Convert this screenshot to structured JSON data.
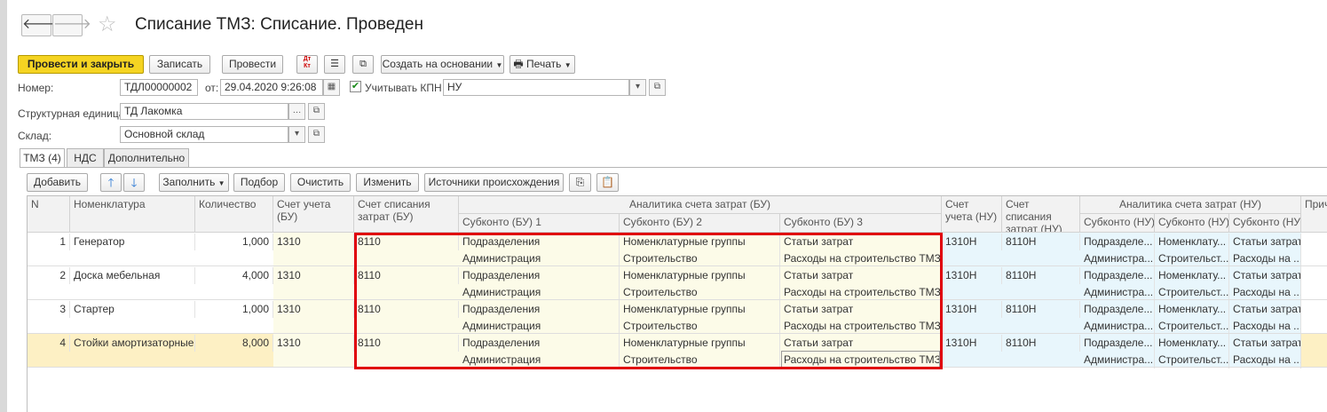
{
  "window": {
    "title": "Списание ТМЗ: Списание. Проведен"
  },
  "nav": {
    "back_glyph": "🡐",
    "forward_glyph": "🡒",
    "star_glyph": "☆"
  },
  "toolbar": {
    "post_close": "Провести и закрыть",
    "save": "Записать",
    "post": "Провести",
    "dtkt": "Дт Кт",
    "create_based": "Создать на основании",
    "print": "Печать"
  },
  "form": {
    "number_label": "Номер:",
    "number_value": "ТДЛ00000002",
    "date_label": "от:",
    "date_value": "29.04.2020  9:26:08",
    "kpn_label": "Учитывать КПН",
    "kpn_checked": true,
    "tax_value": "НУ",
    "unit_label": "Структурная единица:",
    "unit_value": "ТД Лакомка",
    "warehouse_label": "Склад:",
    "warehouse_value": "Основной склад"
  },
  "tabs": [
    "ТМЗ (4)",
    "НДС",
    "Дополнительно"
  ],
  "table_toolbar": {
    "add": "Добавить",
    "fill": "Заполнить",
    "select": "Подбор",
    "clear": "Очистить",
    "change": "Изменить",
    "sources": "Источники происхождения"
  },
  "table": {
    "headers": {
      "n": "N",
      "item": "Номенклатура",
      "qty": "Количество",
      "acct_bu": "Счет учета (БУ)",
      "wo_bu": "Счет списания затрат (БУ)",
      "analytics_bu": "Аналитика счета затрат (БУ)",
      "sub_bu1": "Субконто (БУ) 1",
      "sub_bu2": "Субконто (БУ) 2",
      "sub_bu3": "Субконто (БУ) 3",
      "acct_nu": "Счет учета (НУ)",
      "wo_nu": "Счет списания затрат (НУ)",
      "analytics_nu": "Аналитика счета затрат (НУ)",
      "sub_nu1": "Субконто (НУ)",
      "sub_nu2": "Субконто (НУ)",
      "sub_nu3": "Субконто (НУ)",
      "reason": "Прич"
    },
    "rows": [
      {
        "n": "1",
        "item": "Генератор",
        "qty": "1,000",
        "acct_bu": "1310",
        "wo_bu": "8110",
        "s1a": "Подразделения",
        "s1b": "Администрация",
        "s2a": "Номенклатурные группы",
        "s2b": "Строительство",
        "s3a": "Статьи затрат",
        "s3b": "Расходы на строительство ТМЗ",
        "acct_nu": "1310Н",
        "wo_nu": "8110Н",
        "n1a": "Подразделе...",
        "n1b": "Администра...",
        "n2a": "Номенклату...",
        "n2b": "Строительст...",
        "n3a": "Статьи затрат",
        "n3b": "Расходы на ..."
      },
      {
        "n": "2",
        "item": "Доска мебельная",
        "qty": "4,000",
        "acct_bu": "1310",
        "wo_bu": "8110",
        "s1a": "Подразделения",
        "s1b": "Администрация",
        "s2a": "Номенклатурные группы",
        "s2b": "Строительство",
        "s3a": "Статьи затрат",
        "s3b": "Расходы на строительство ТМЗ",
        "acct_nu": "1310Н",
        "wo_nu": "8110Н",
        "n1a": "Подразделе...",
        "n1b": "Администра...",
        "n2a": "Номенклату...",
        "n2b": "Строительст...",
        "n3a": "Статьи затрат",
        "n3b": "Расходы на ..."
      },
      {
        "n": "3",
        "item": "Стартер",
        "qty": "1,000",
        "acct_bu": "1310",
        "wo_bu": "8110",
        "s1a": "Подразделения",
        "s1b": "Администрация",
        "s2a": "Номенклатурные группы",
        "s2b": "Строительство",
        "s3a": "Статьи затрат",
        "s3b": "Расходы на строительство ТМЗ",
        "acct_nu": "1310Н",
        "wo_nu": "8110Н",
        "n1a": "Подразделе...",
        "n1b": "Администра...",
        "n2a": "Номенклату...",
        "n2b": "Строительст...",
        "n3a": "Статьи затрат",
        "n3b": "Расходы на ..."
      },
      {
        "n": "4",
        "item": "Стойки амортизаторные",
        "qty": "8,000",
        "acct_bu": "1310",
        "wo_bu": "8110",
        "s1a": "Подразделения",
        "s1b": "Администрация",
        "s2a": "Номенклатурные группы",
        "s2b": "Строительство",
        "s3a": "Статьи затрат",
        "s3b": "Расходы на строительство ТМЗ",
        "acct_nu": "1310Н",
        "wo_nu": "8110Н",
        "n1a": "Подразделе...",
        "n1b": "Администра...",
        "n2a": "Номенклату...",
        "n2b": "Строительст...",
        "n3a": "Статьи затрат",
        "n3b": "Расходы на ..."
      }
    ],
    "selected_row": 3
  },
  "colors": {
    "primary": "#f5d422",
    "bu_col": "#fcfbe8",
    "nu_col": "#e8f6fc",
    "selected": "#fdf0c4",
    "highlight": "#e0000a"
  }
}
